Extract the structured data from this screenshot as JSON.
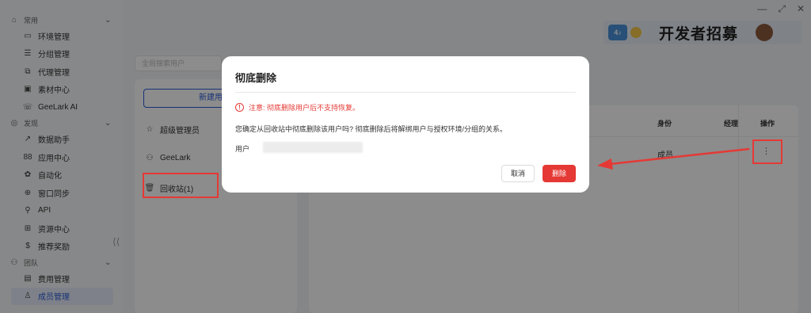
{
  "window_controls": {
    "minimize": "—",
    "restore": "⤢",
    "close": "✕"
  },
  "banner": {
    "logo_text": "4♪",
    "text": "开发者招募"
  },
  "sidebar": {
    "sections": [
      {
        "label": "常用",
        "icon": "⌂",
        "chevron": "⌄",
        "items": [
          {
            "label": "环境管理",
            "icon": "▭"
          },
          {
            "label": "分组管理",
            "icon": "☰"
          },
          {
            "label": "代理管理",
            "icon": "⧉"
          },
          {
            "label": "素材中心",
            "icon": "▣"
          },
          {
            "label": "GeeLark AI",
            "icon": "☏"
          }
        ]
      },
      {
        "label": "发现",
        "icon": "◎",
        "chevron": "⌄",
        "items": [
          {
            "label": "数据助手",
            "icon": "↗"
          },
          {
            "label": "应用中心",
            "icon": "88"
          },
          {
            "label": "自动化",
            "icon": "✿"
          },
          {
            "label": "窗口同步",
            "icon": "⊕"
          },
          {
            "label": "API",
            "icon": "⚲"
          },
          {
            "label": "资源中心",
            "icon": "⊞"
          },
          {
            "label": "推荐奖励",
            "icon": "$"
          }
        ]
      },
      {
        "label": "团队",
        "icon": "⚇",
        "chevron": "⌄",
        "items": [
          {
            "label": "费用管理",
            "icon": "▤"
          },
          {
            "label": "成员管理",
            "icon": "♙"
          }
        ]
      }
    ],
    "collapse_icon": "⟨⟨"
  },
  "main": {
    "search_placeholder": "全局搜索用户",
    "new_button": "新建用户",
    "groups": [
      {
        "label": "超级管理员",
        "icon": "☆"
      },
      {
        "label": "GeeLark",
        "icon": "⚇"
      },
      {
        "label": "回收站(1)",
        "icon": "🗑"
      }
    ],
    "table": {
      "headers": {
        "identity": "身份",
        "manager": "经理",
        "actions": "操作"
      },
      "rows": [
        {
          "identity": "成员",
          "more": "⋮"
        }
      ]
    }
  },
  "modal": {
    "title": "彻底删除",
    "warning": "注意: 彻底删除用户后不支持恢复。",
    "warning_icon": "!",
    "description": "您确定从回收站中彻底删除该用户吗? 彻底删除后将解绑用户与授权环境/分组的关系。",
    "user_label": "用户",
    "cancel_label": "取消",
    "delete_label": "删除"
  }
}
